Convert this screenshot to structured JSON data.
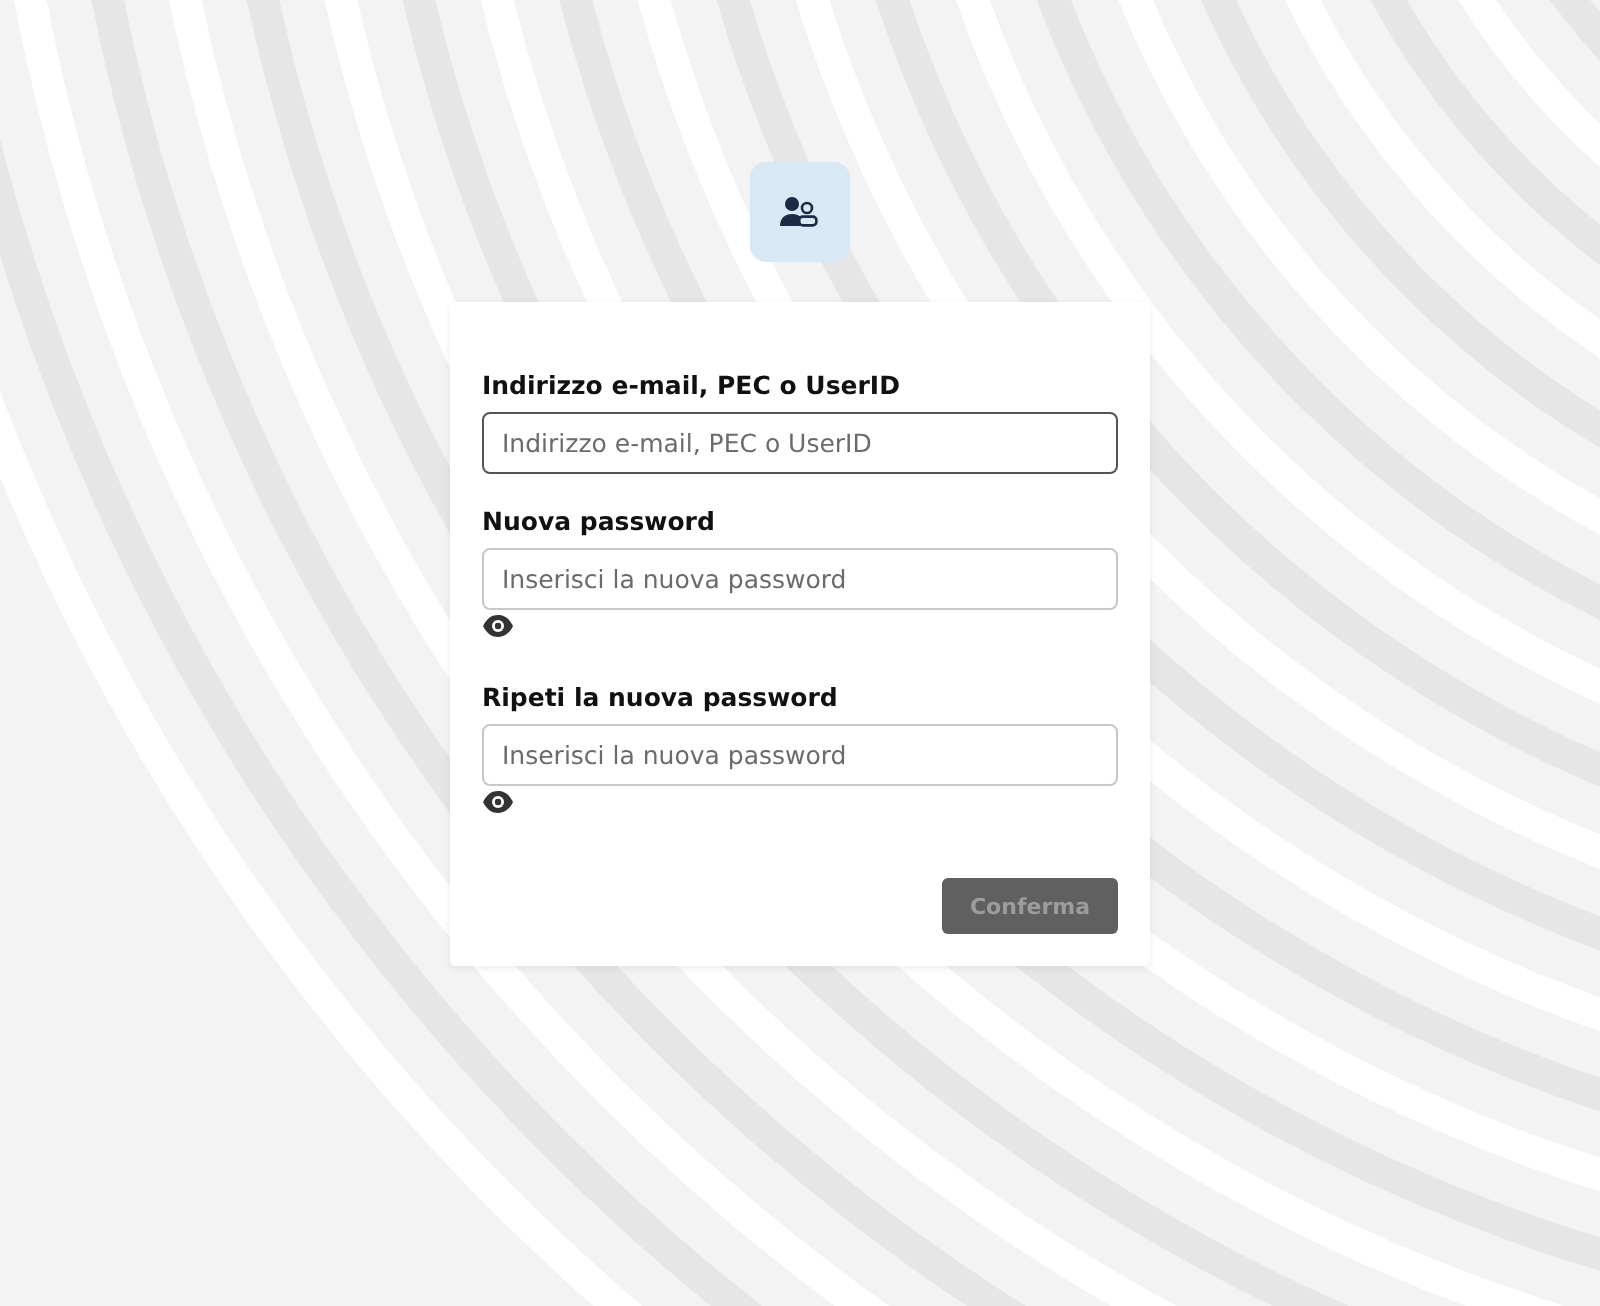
{
  "fields": [
    {
      "kind": "text",
      "label": "Indirizzo e-mail, PEC o UserID",
      "placeholder": "Indirizzo e-mail, PEC o UserID",
      "focused": true
    },
    {
      "kind": "password",
      "label": "Nuova password",
      "placeholder": "Inserisci la nuova password",
      "focused": false
    },
    {
      "kind": "password",
      "label": "Ripeti la nuova password",
      "placeholder": "Inserisci la nuova password",
      "focused": false
    }
  ],
  "submit": {
    "label": "Conferma",
    "disabled": true
  }
}
